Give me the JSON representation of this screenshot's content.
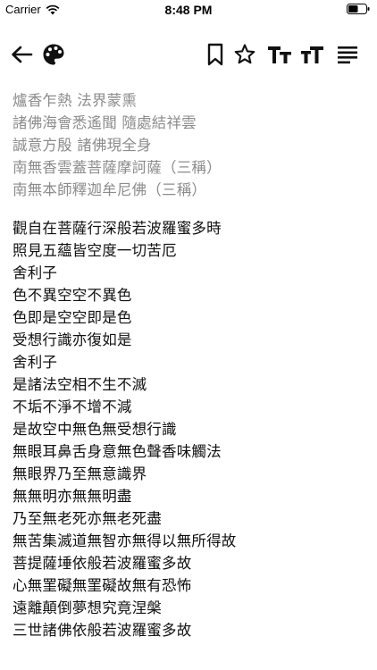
{
  "status_bar": {
    "carrier": "Carrier",
    "time": "8:48 PM",
    "battery_level": 0.55
  },
  "toolbar": {
    "icons": [
      "back-arrow-icon",
      "palette-icon",
      "bookmark-icon",
      "star-icon",
      "increase-font-icon",
      "decrease-font-icon",
      "align-left-icon"
    ]
  },
  "invocation": [
    "爐香乍熱 法界蒙熏",
    "諸佛海會悉遙聞 隨處結祥雲",
    "誠意方殷 諸佛現全身",
    "南無香雲蓋菩薩摩訶薩（三稱）",
    "南無本師釋迦牟尼佛（三稱）"
  ],
  "sutra": [
    "觀自在菩薩行深般若波羅蜜多時",
    "照見五蘊皆空度一切苦厄",
    "舍利子",
    "色不異空空不異色",
    "色即是空空即是色",
    "受想行識亦復如是",
    "舍利子",
    "是諸法空相不生不滅",
    "不垢不淨不增不減",
    "是故空中無色無受想行識",
    "無眼耳鼻舌身意無色聲香味觸法",
    "無眼界乃至無意識界",
    "無無明亦無無明盡",
    "乃至無老死亦無老死盡",
    "無苦集滅道無智亦無得以無所得故",
    "菩提薩埵依般若波羅蜜多故",
    "心無罣礙無罣礙故無有恐怖",
    "遠離顛倒夢想究竟涅槃",
    "三世諸佛依般若波羅蜜多故"
  ]
}
